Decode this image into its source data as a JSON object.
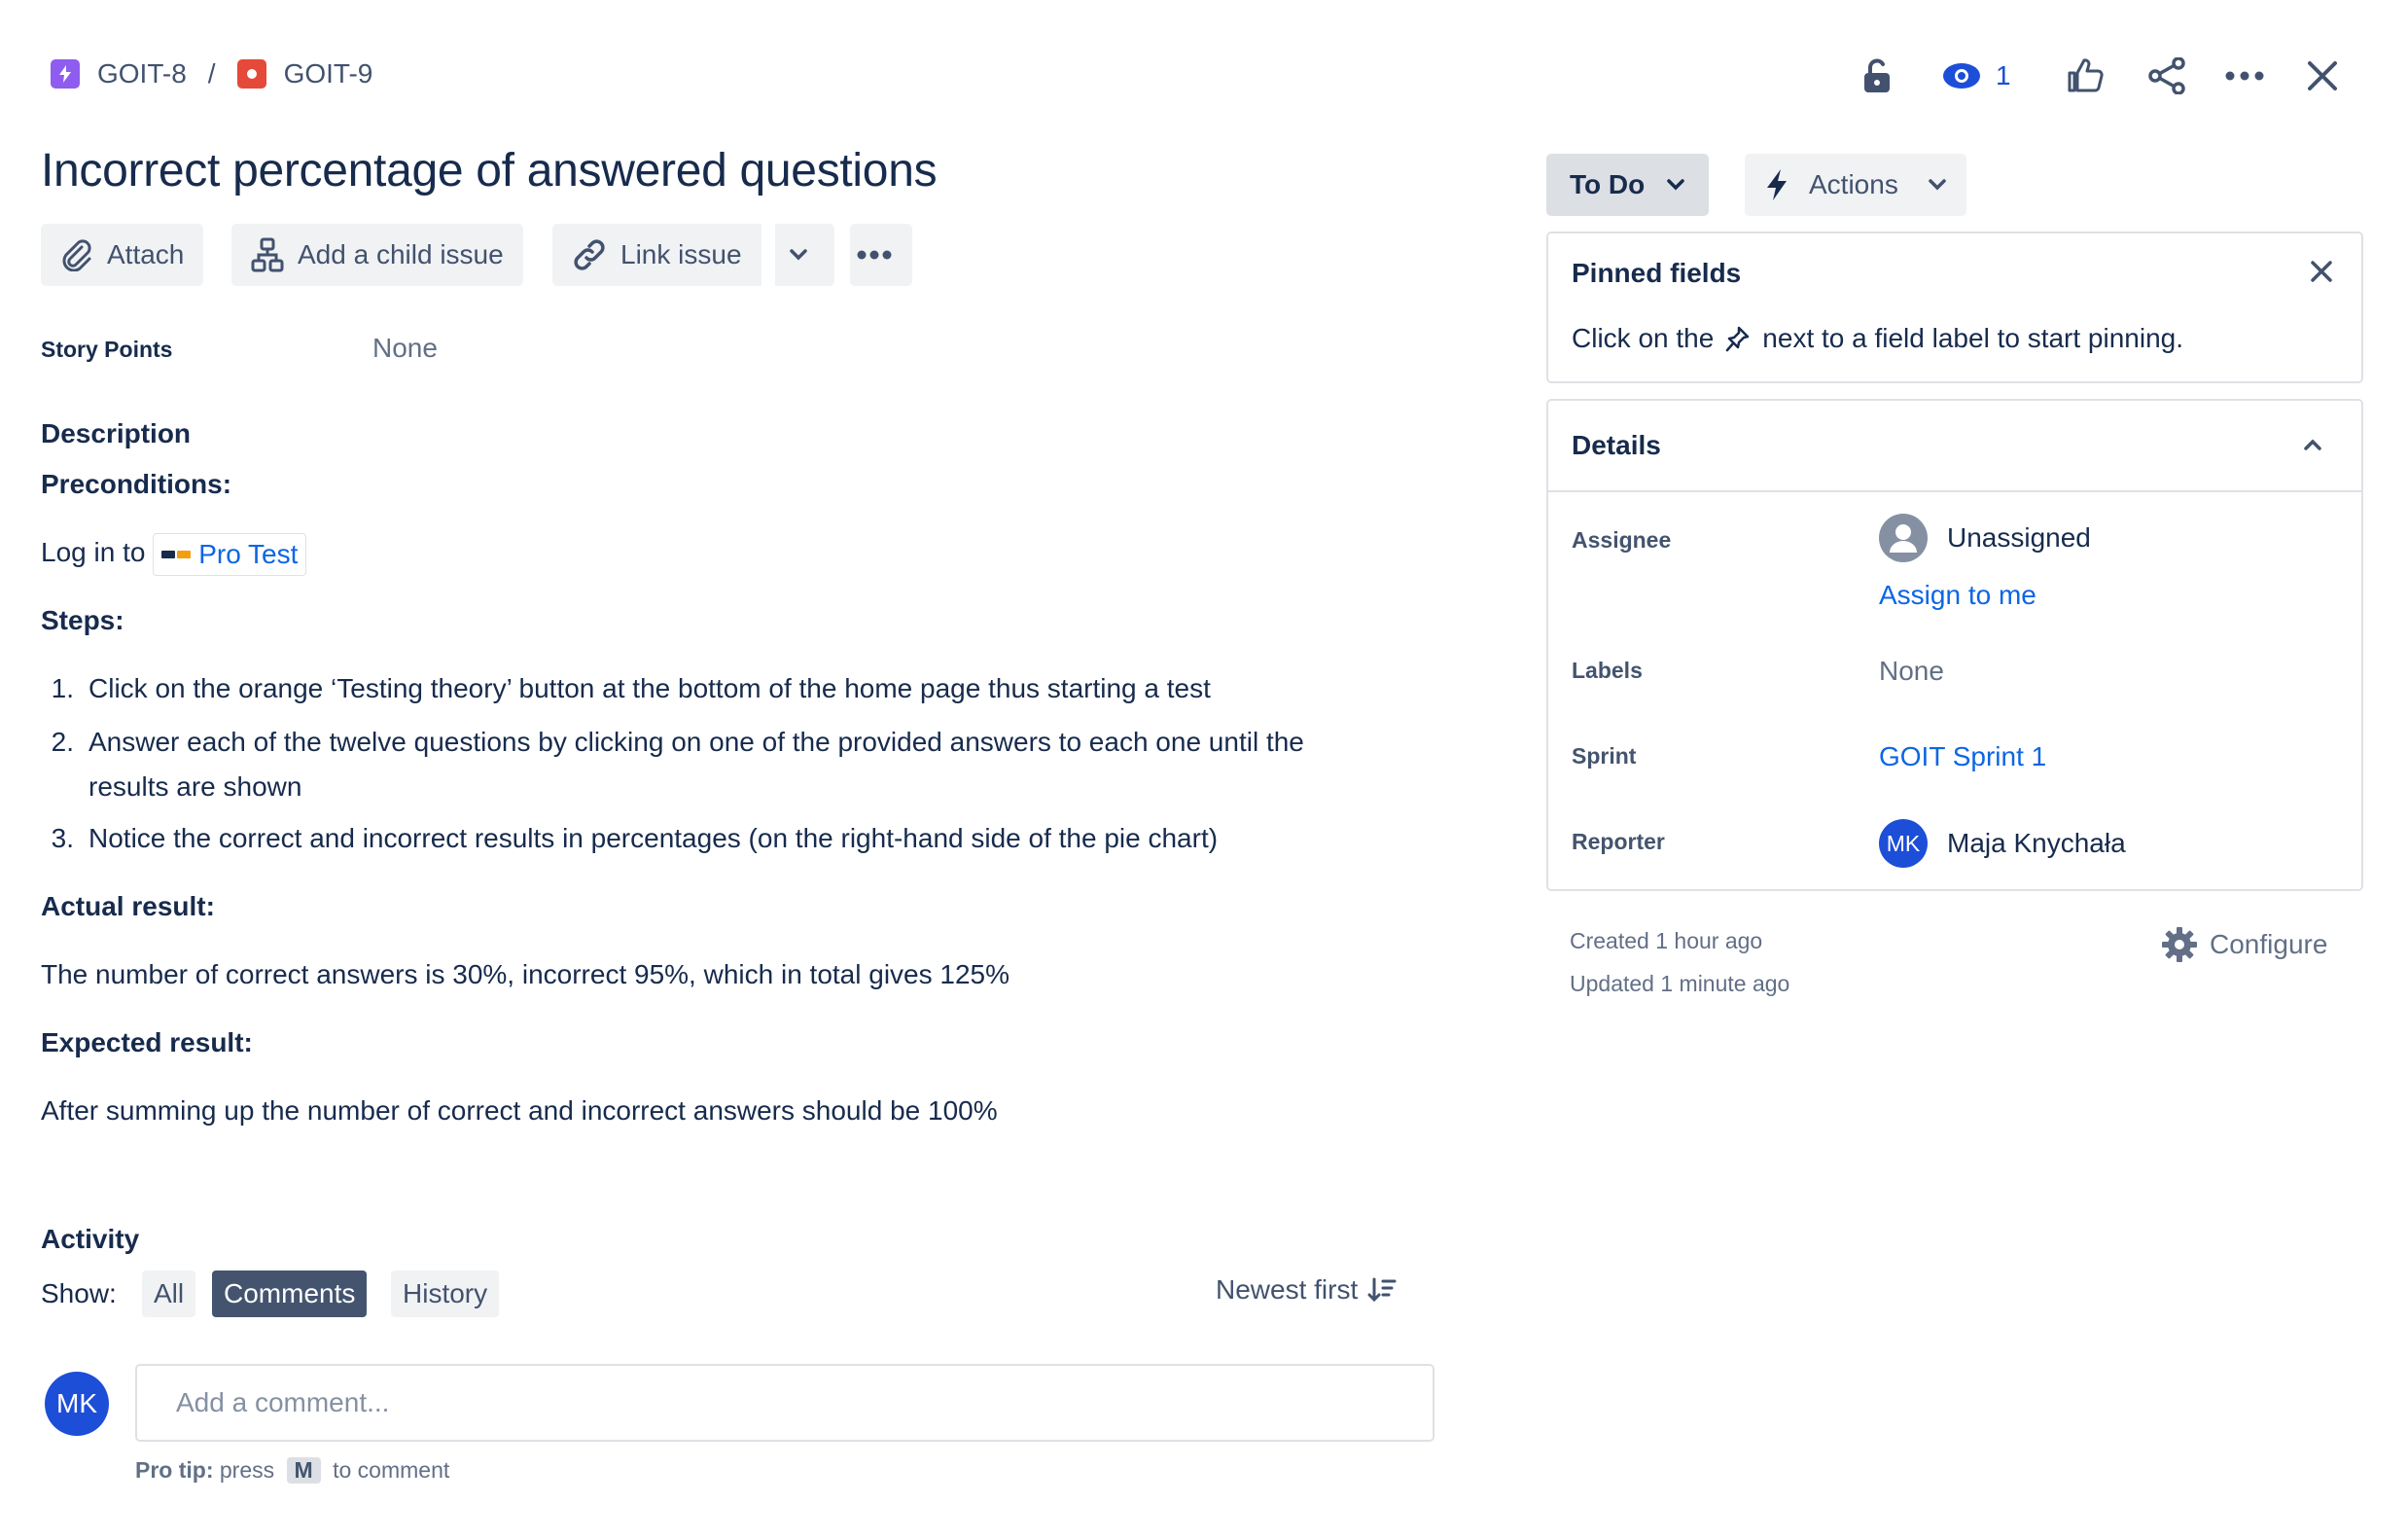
{
  "breadcrumb": {
    "parent": "GOIT-8",
    "separator": "/",
    "current": "GOIT-9",
    "parent_color": "#8f5cf0",
    "current_color": "#e5493a"
  },
  "header": {
    "watchers_count": "1",
    "icons": [
      "lock-icon",
      "eye-icon",
      "thumbs-up-icon",
      "share-icon",
      "more-icon",
      "close-icon"
    ]
  },
  "issue": {
    "title": "Incorrect percentage of answered questions"
  },
  "toolbar": {
    "attach": "Attach",
    "add_child": "Add a child issue",
    "link_issue": "Link issue"
  },
  "story_points": {
    "label": "Story Points",
    "value": "None"
  },
  "description": {
    "heading": "Description",
    "preconditions_label": "Preconditions:",
    "login_prefix": "Log in to",
    "login_link": "Pro Test",
    "steps_label": "Steps:",
    "steps": [
      {
        "num": "1.",
        "text": "Click on the orange  ‘Testing theory’ button at the bottom of the home page thus starting a test"
      },
      {
        "num": "2.",
        "text": "Answer each of the twelve questions by clicking on one of the provided answers to each one until the results are shown"
      },
      {
        "num": "3.",
        "text": "Notice the  correct and incorrect results in percentages (on the right-hand side of the pie chart)"
      }
    ],
    "actual_label": "Actual result:",
    "actual_text": "The number of correct answers is 30%, incorrect 95%, which in total gives 125%",
    "expected_label": "Expected result:",
    "expected_text": "After summing up the number of correct and incorrect answers should be 100%"
  },
  "activity": {
    "heading": "Activity",
    "show_label": "Show:",
    "tabs": [
      "All",
      "Comments",
      "History"
    ],
    "active_tab": "Comments",
    "sort_label": "Newest first",
    "comment_placeholder": "Add a comment...",
    "avatar_initials": "MK",
    "pro_tip_label": "Pro tip:",
    "pro_tip_press": "press",
    "pro_tip_key": "M",
    "pro_tip_suffix": "to comment"
  },
  "status": {
    "current": "To Do",
    "actions_label": "Actions"
  },
  "pinned": {
    "title": "Pinned fields",
    "hint_prefix": "Click on the",
    "hint_suffix": "next to a field label to start pinning."
  },
  "details": {
    "title": "Details",
    "assignee_label": "Assignee",
    "assignee_value": "Unassigned",
    "assign_to_me": "Assign to me",
    "labels_label": "Labels",
    "labels_value": "None",
    "sprint_label": "Sprint",
    "sprint_value": "GOIT Sprint 1",
    "reporter_label": "Reporter",
    "reporter_initials": "MK",
    "reporter_name": "Maja Knychała"
  },
  "meta": {
    "created": "Created 1 hour ago",
    "updated": "Updated 1 minute ago",
    "configure": "Configure"
  },
  "colors": {
    "link": "#0c66e4",
    "text": "#172b4d",
    "subtle": "#42526e",
    "avatar": "#1d4ed8",
    "active_tab_bg": "#44546f"
  }
}
